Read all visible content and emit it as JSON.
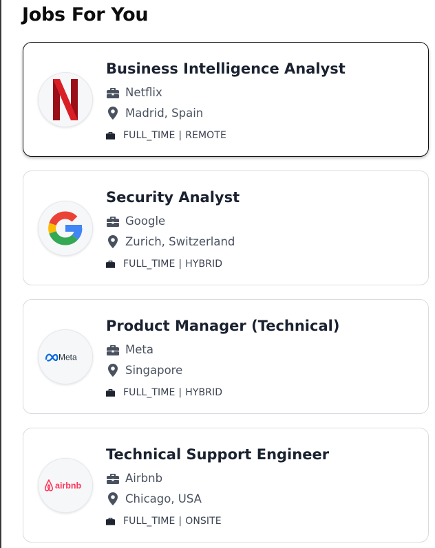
{
  "page": {
    "title": "Jobs For You"
  },
  "jobs": [
    {
      "title": "Business Intelligence Analyst",
      "company": "Netflix",
      "location": "Madrid, Spain",
      "employment_type": "FULL_TIME",
      "work_mode": "REMOTE",
      "logo": "netflix-logo",
      "selected": true
    },
    {
      "title": "Security Analyst",
      "company": "Google",
      "location": "Zurich, Switzerland",
      "employment_type": "FULL_TIME",
      "work_mode": "HYBRID",
      "logo": "google-logo",
      "selected": false
    },
    {
      "title": "Product Manager (Technical)",
      "company": "Meta",
      "location": "Singapore",
      "employment_type": "FULL_TIME",
      "work_mode": "HYBRID",
      "logo": "meta-logo",
      "logo_text": "Meta",
      "selected": false
    },
    {
      "title": "Technical Support Engineer",
      "company": "Airbnb",
      "location": "Chicago, USA",
      "employment_type": "FULL_TIME",
      "work_mode": "ONSITE",
      "logo": "airbnb-logo",
      "logo_text": "airbnb",
      "selected": false
    }
  ],
  "icons": {
    "company": "briefcase-icon",
    "location": "map-pin-icon",
    "meta": "briefcase-icon"
  },
  "colors": {
    "netflix_red": "#c1121f",
    "meta_blue": "#0668e1",
    "airbnb_red": "#ff385c"
  }
}
